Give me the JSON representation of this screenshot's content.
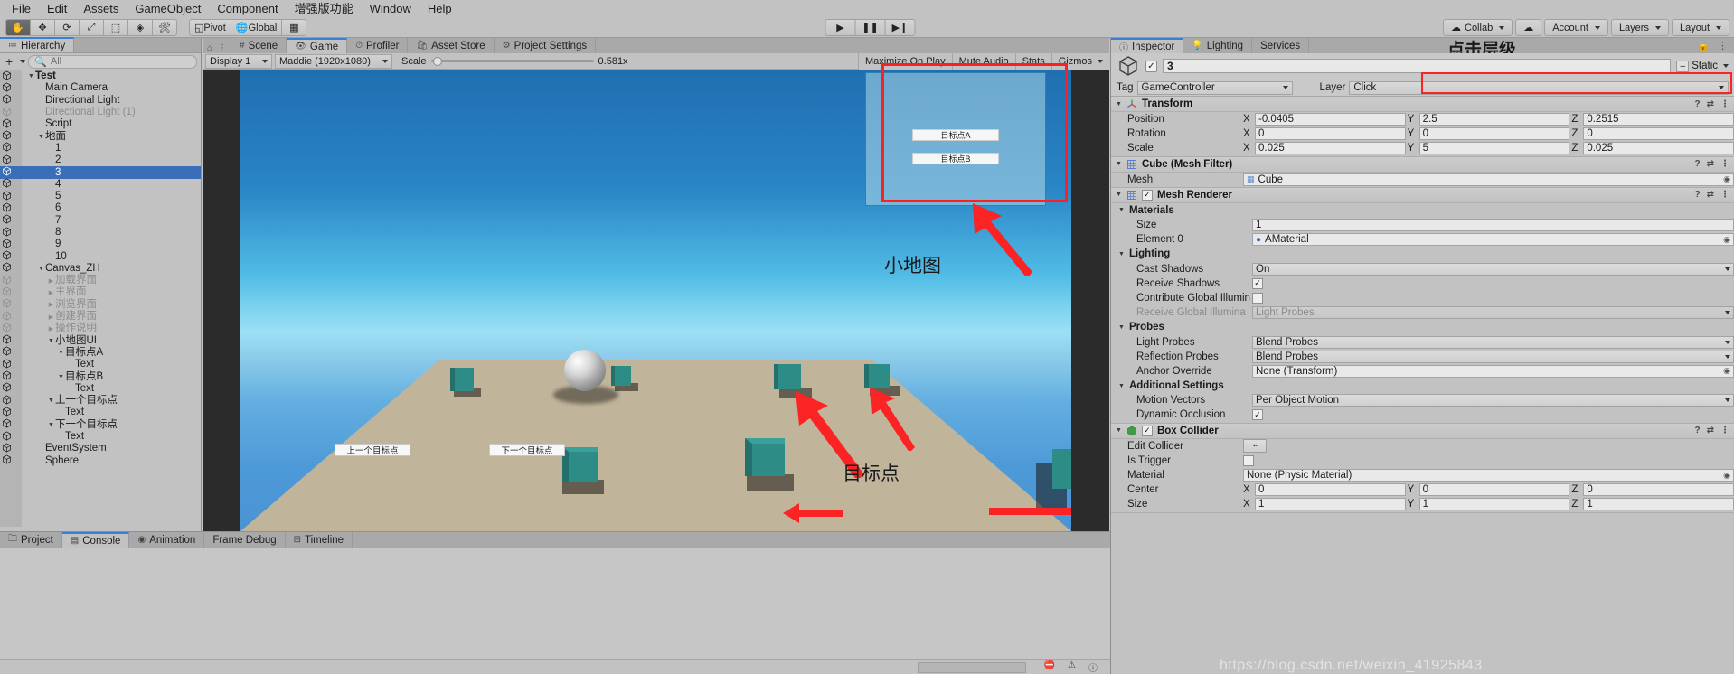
{
  "menubar": {
    "items": [
      "File",
      "Edit",
      "Assets",
      "GameObject",
      "Component",
      "增强版功能",
      "Window",
      "Help"
    ]
  },
  "toolbar": {
    "transform_tools": [
      "hand-tool",
      "move-tool",
      "rotate-tool",
      "scale-tool",
      "rect-tool",
      "transform-tool",
      "custom-tool"
    ],
    "pivot_label": "Pivot",
    "global_label": "Global",
    "play_label": "▶",
    "pause_label": "❚❚",
    "step_label": "▶❙",
    "collab_label": "Collab",
    "cloud_label": "☁",
    "account_label": "Account",
    "layers_label": "Layers",
    "layout_label": "Layout"
  },
  "hierarchy": {
    "tab_label": "Hierarchy",
    "plus_label": "+",
    "search_placeholder": "All",
    "items": [
      {
        "label": "Test",
        "depth": 0,
        "arrow": "▼",
        "selected": false,
        "dim": false,
        "bold": true,
        "icon": "scene-icon"
      },
      {
        "label": "Main Camera",
        "depth": 1,
        "arrow": "",
        "selected": false,
        "dim": false,
        "bold": false,
        "icon": "cube-icon"
      },
      {
        "label": "Directional Light",
        "depth": 1,
        "arrow": "",
        "selected": false,
        "dim": false,
        "bold": false,
        "icon": "cube-icon"
      },
      {
        "label": "Directional Light (1)",
        "depth": 1,
        "arrow": "",
        "selected": false,
        "dim": true,
        "bold": false,
        "icon": "cube-icon"
      },
      {
        "label": "Script",
        "depth": 1,
        "arrow": "",
        "selected": false,
        "dim": false,
        "bold": false,
        "icon": "cube-icon"
      },
      {
        "label": "地面",
        "depth": 1,
        "arrow": "▼",
        "selected": false,
        "dim": false,
        "bold": false,
        "icon": "cube-icon"
      },
      {
        "label": "1",
        "depth": 2,
        "arrow": "",
        "selected": false,
        "dim": false,
        "bold": false,
        "icon": "cube-icon"
      },
      {
        "label": "2",
        "depth": 2,
        "arrow": "",
        "selected": false,
        "dim": false,
        "bold": false,
        "icon": "cube-icon"
      },
      {
        "label": "3",
        "depth": 2,
        "arrow": "",
        "selected": true,
        "dim": false,
        "bold": false,
        "icon": "cube-icon"
      },
      {
        "label": "4",
        "depth": 2,
        "arrow": "",
        "selected": false,
        "dim": false,
        "bold": false,
        "icon": "cube-icon"
      },
      {
        "label": "5",
        "depth": 2,
        "arrow": "",
        "selected": false,
        "dim": false,
        "bold": false,
        "icon": "cube-icon"
      },
      {
        "label": "6",
        "depth": 2,
        "arrow": "",
        "selected": false,
        "dim": false,
        "bold": false,
        "icon": "cube-icon"
      },
      {
        "label": "7",
        "depth": 2,
        "arrow": "",
        "selected": false,
        "dim": false,
        "bold": false,
        "icon": "cube-icon"
      },
      {
        "label": "8",
        "depth": 2,
        "arrow": "",
        "selected": false,
        "dim": false,
        "bold": false,
        "icon": "cube-icon"
      },
      {
        "label": "9",
        "depth": 2,
        "arrow": "",
        "selected": false,
        "dim": false,
        "bold": false,
        "icon": "cube-icon"
      },
      {
        "label": "10",
        "depth": 2,
        "arrow": "",
        "selected": false,
        "dim": false,
        "bold": false,
        "icon": "cube-icon"
      },
      {
        "label": "Canvas_ZH",
        "depth": 1,
        "arrow": "▼",
        "selected": false,
        "dim": false,
        "bold": false,
        "icon": "cube-icon"
      },
      {
        "label": "加载界面",
        "depth": 2,
        "arrow": "▶",
        "selected": false,
        "dim": true,
        "bold": false,
        "icon": "cube-icon"
      },
      {
        "label": "主界面",
        "depth": 2,
        "arrow": "▶",
        "selected": false,
        "dim": true,
        "bold": false,
        "icon": "cube-icon"
      },
      {
        "label": "浏览界面",
        "depth": 2,
        "arrow": "▶",
        "selected": false,
        "dim": true,
        "bold": false,
        "icon": "cube-icon"
      },
      {
        "label": "创建界面",
        "depth": 2,
        "arrow": "▶",
        "selected": false,
        "dim": true,
        "bold": false,
        "icon": "cube-icon"
      },
      {
        "label": "操作说明",
        "depth": 2,
        "arrow": "▶",
        "selected": false,
        "dim": true,
        "bold": false,
        "icon": "cube-icon"
      },
      {
        "label": "小地图UI",
        "depth": 2,
        "arrow": "▼",
        "selected": false,
        "dim": false,
        "bold": false,
        "icon": "cube-icon"
      },
      {
        "label": "目标点A",
        "depth": 3,
        "arrow": "▼",
        "selected": false,
        "dim": false,
        "bold": false,
        "icon": "cube-icon"
      },
      {
        "label": "Text",
        "depth": 4,
        "arrow": "",
        "selected": false,
        "dim": false,
        "bold": false,
        "icon": "cube-icon"
      },
      {
        "label": "目标点B",
        "depth": 3,
        "arrow": "▼",
        "selected": false,
        "dim": false,
        "bold": false,
        "icon": "cube-icon"
      },
      {
        "label": "Text",
        "depth": 4,
        "arrow": "",
        "selected": false,
        "dim": false,
        "bold": false,
        "icon": "cube-icon"
      },
      {
        "label": "上一个目标点",
        "depth": 2,
        "arrow": "▼",
        "selected": false,
        "dim": false,
        "bold": false,
        "icon": "cube-icon"
      },
      {
        "label": "Text",
        "depth": 3,
        "arrow": "",
        "selected": false,
        "dim": false,
        "bold": false,
        "icon": "cube-icon"
      },
      {
        "label": "下一个目标点",
        "depth": 2,
        "arrow": "▼",
        "selected": false,
        "dim": false,
        "bold": false,
        "icon": "cube-icon"
      },
      {
        "label": "Text",
        "depth": 3,
        "arrow": "",
        "selected": false,
        "dim": false,
        "bold": false,
        "icon": "cube-icon"
      },
      {
        "label": "EventSystem",
        "depth": 1,
        "arrow": "",
        "selected": false,
        "dim": false,
        "bold": false,
        "icon": "cube-icon"
      },
      {
        "label": "Sphere",
        "depth": 1,
        "arrow": "",
        "selected": false,
        "dim": false,
        "bold": false,
        "icon": "cube-icon"
      }
    ]
  },
  "gameview": {
    "tabs": [
      {
        "label": "Scene",
        "icon": "grid-icon",
        "active": false
      },
      {
        "label": "Game",
        "icon": "gamepad-icon",
        "active": true
      },
      {
        "label": "Profiler",
        "icon": "stopwatch-icon",
        "active": false
      },
      {
        "label": "Asset Store",
        "icon": "bag-icon",
        "active": false
      },
      {
        "label": "Project Settings",
        "icon": "gear-icon",
        "active": false
      }
    ],
    "display": "Display 1",
    "resolution": "Maddie (1920x1080)",
    "scale_label": "Scale",
    "scale_value": "0.581x",
    "maximize_on_play": "Maximize On Play",
    "mute_audio": "Mute Audio",
    "stats": "Stats",
    "gizmos": "Gizmos",
    "minimap": {
      "button_a": "目标点A",
      "button_b": "目标点B"
    },
    "overlay_labels": {
      "minimap_caption": "小地图",
      "target_caption": "目标点"
    },
    "hud_buttons": [
      {
        "label": "上一个目标点"
      },
      {
        "label": "下一个目标点"
      }
    ]
  },
  "inspector": {
    "tabs": [
      {
        "label": "Inspector",
        "icon": "info-icon",
        "active": true
      },
      {
        "label": "Lighting",
        "icon": "bulb-icon",
        "active": false
      },
      {
        "label": "Services",
        "icon": "",
        "active": false
      }
    ],
    "annotation": "点击层级",
    "lock_icon": "lock-icon",
    "menu_icon": "kebab-icon",
    "object_name": "3",
    "static_label": "Static",
    "tag_label": "Tag",
    "tag_value": "GameController",
    "layer_label": "Layer",
    "layer_value": "Click",
    "components": [
      {
        "name": "Transform",
        "icon": "transform-icon",
        "has_checkbox": false,
        "rows": [
          {
            "kind": "vec3",
            "label": "Position",
            "x": "-0.0405",
            "y": "2.5",
            "z": "0.2515"
          },
          {
            "kind": "vec3",
            "label": "Rotation",
            "x": "0",
            "y": "0",
            "z": "0"
          },
          {
            "kind": "vec3",
            "label": "Scale",
            "x": "0.025",
            "y": "5",
            "z": "0.025"
          }
        ]
      },
      {
        "name": "Cube (Mesh Filter)",
        "icon": "mesh-filter-icon",
        "has_checkbox": false,
        "rows": [
          {
            "kind": "object",
            "label": "Mesh",
            "value": "Cube",
            "swatch": "mesh"
          }
        ]
      },
      {
        "name": "Mesh Renderer",
        "icon": "mesh-renderer-icon",
        "has_checkbox": true,
        "checked": true,
        "rows": [
          {
            "kind": "group",
            "label": "Materials"
          },
          {
            "kind": "text",
            "label": "Size",
            "value": "1",
            "indent": 2
          },
          {
            "kind": "object",
            "label": "Element 0",
            "value": "AMaterial",
            "swatch": "material",
            "indent": 2
          },
          {
            "kind": "group",
            "label": "Lighting"
          },
          {
            "kind": "dropdown",
            "label": "Cast Shadows",
            "value": "On",
            "indent": 2
          },
          {
            "kind": "checkbox",
            "label": "Receive Shadows",
            "checked": true,
            "indent": 2
          },
          {
            "kind": "checkbox",
            "label": "Contribute Global Illumin",
            "checked": false,
            "indent": 2
          },
          {
            "kind": "dropdown",
            "label": "Receive Global Illumina",
            "value": "Light Probes",
            "dim": true,
            "indent": 2
          },
          {
            "kind": "group",
            "label": "Probes"
          },
          {
            "kind": "dropdown",
            "label": "Light Probes",
            "value": "Blend Probes",
            "indent": 2
          },
          {
            "kind": "dropdown",
            "label": "Reflection Probes",
            "value": "Blend Probes",
            "indent": 2
          },
          {
            "kind": "object",
            "label": "Anchor Override",
            "value": "None (Transform)",
            "indent": 2
          },
          {
            "kind": "group",
            "label": "Additional Settings"
          },
          {
            "kind": "dropdown",
            "label": "Motion Vectors",
            "value": "Per Object Motion",
            "indent": 2
          },
          {
            "kind": "checkbox",
            "label": "Dynamic Occlusion",
            "checked": true,
            "indent": 2
          }
        ]
      },
      {
        "name": "Box Collider",
        "icon": "box-collider-icon",
        "has_checkbox": true,
        "checked": true,
        "rows": [
          {
            "kind": "editbtn",
            "label": "Edit Collider"
          },
          {
            "kind": "checkbox",
            "label": "Is Trigger",
            "checked": false
          },
          {
            "kind": "object",
            "label": "Material",
            "value": "None (Physic Material)"
          },
          {
            "kind": "vec3",
            "label": "Center",
            "x": "0",
            "y": "0",
            "z": "0"
          },
          {
            "kind": "vec3",
            "label": "Size",
            "x": "1",
            "y": "1",
            "z": "1"
          }
        ]
      }
    ]
  },
  "bottom": {
    "tabs": [
      {
        "label": "Project",
        "icon": "folder-icon",
        "active": false
      },
      {
        "label": "Console",
        "icon": "console-icon",
        "active": true
      },
      {
        "label": "Animation",
        "icon": "anim-icon",
        "active": false
      },
      {
        "label": "Frame Debug",
        "icon": "",
        "active": false
      },
      {
        "label": "Timeline",
        "icon": "timeline-icon",
        "active": false
      }
    ]
  },
  "watermark": {
    "text": "https://blog.csdn.net/weixin_41925843"
  },
  "colors": {
    "accent_selection": "#3a6fb8",
    "annotation_red": "#fe2020",
    "panel_bg": "#c2c2c2",
    "tab_bg": "#a9a9a9"
  }
}
